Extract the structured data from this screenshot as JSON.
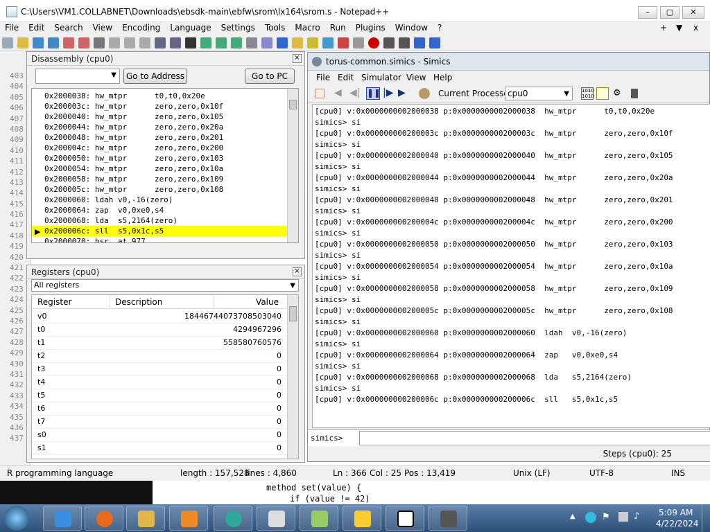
{
  "window": {
    "title": "C:\\Users\\VM1.COLLABNET\\Downloads\\ebsdk-main\\ebfw\\srom\\lx164\\srom.s - Notepad++"
  },
  "menu": [
    "File",
    "Edit",
    "Search",
    "View",
    "Encoding",
    "Language",
    "Settings",
    "Tools",
    "Macro",
    "Run",
    "Plugins",
    "Window",
    "?"
  ],
  "menu_right": {
    "plus": "+",
    "down": "▼",
    "close": "x"
  },
  "line_numbers": [
    "403",
    "404",
    "405",
    "406",
    "407",
    "408",
    "409",
    "410",
    "411",
    "412",
    "413",
    "414",
    "415",
    "416",
    "417",
    "418",
    "419",
    "420",
    "421",
    "422",
    "423",
    "424",
    "425",
    "426",
    "427",
    "428",
    "429",
    "430",
    "431",
    "432",
    "433",
    "434",
    "435",
    "436",
    "437"
  ],
  "disassembly": {
    "title": "Disassembly (cpu0)",
    "go_address": "Go to Address",
    "go_pc": "Go to PC",
    "rows": [
      "0x2000038: hw_mtpr      t0,t0,0x20e",
      "0x200003c: hw_mtpr      zero,zero,0x10f",
      "0x2000040: hw_mtpr      zero,zero,0x105",
      "0x2000044: hw_mtpr      zero,zero,0x20a",
      "0x2000048: hw_mtpr      zero,zero,0x201",
      "0x200004c: hw_mtpr      zero,zero,0x200",
      "0x2000050: hw_mtpr      zero,zero,0x103",
      "0x2000054: hw_mtpr      zero,zero,0x10a",
      "0x2000058: hw_mtpr      zero,zero,0x109",
      "0x200005c: hw_mtpr      zero,zero,0x108",
      "0x2000060: ldah v0,-16(zero)",
      "0x2000064: zap  v0,0xe0,s4",
      "0x2000068: lda  s5,2164(zero)",
      "0x200006c: sll  s5,0x1c,s5",
      "0x2000070: bsr  at,977"
    ],
    "highlight_index": 13
  },
  "registers": {
    "title": "Registers (cpu0)",
    "filter": "All registers",
    "headers": [
      "Register",
      "Description",
      "Value"
    ],
    "rows": [
      [
        "v0",
        "",
        "18446744073708503040"
      ],
      [
        "t0",
        "",
        "4294967296"
      ],
      [
        "t1",
        "",
        "558580760576"
      ],
      [
        "t2",
        "",
        "0"
      ],
      [
        "t3",
        "",
        "0"
      ],
      [
        "t4",
        "",
        "0"
      ],
      [
        "t5",
        "",
        "0"
      ],
      [
        "t6",
        "",
        "0"
      ],
      [
        "t7",
        "",
        "0"
      ],
      [
        "s0",
        "",
        "0"
      ],
      [
        "s1",
        "",
        "0"
      ]
    ]
  },
  "simics": {
    "title": "torus-common.simics - Simics",
    "menu": [
      "File",
      "Edit",
      "Simulator",
      "View",
      "Help"
    ],
    "current_processor_label": "Current Processor:",
    "current_processor": "cpu0",
    "console": [
      "[cpu0] v:0x0000000002000038 p:0x0000000002000038  hw_mtpr      t0,t0,0x20e",
      "simics> si",
      "[cpu0] v:0x000000000200003c p:0x000000000200003c  hw_mtpr      zero,zero,0x10f",
      "simics> si",
      "[cpu0] v:0x0000000002000040 p:0x0000000002000040  hw_mtpr      zero,zero,0x105",
      "simics> si",
      "[cpu0] v:0x0000000002000044 p:0x0000000002000044  hw_mtpr      zero,zero,0x20a",
      "simics> si",
      "[cpu0] v:0x0000000002000048 p:0x0000000002000048  hw_mtpr      zero,zero,0x201",
      "simics> si",
      "[cpu0] v:0x000000000200004c p:0x000000000200004c  hw_mtpr      zero,zero,0x200",
      "simics> si",
      "[cpu0] v:0x0000000002000050 p:0x0000000002000050  hw_mtpr      zero,zero,0x103",
      "simics> si",
      "[cpu0] v:0x0000000002000054 p:0x0000000002000054  hw_mtpr      zero,zero,0x10a",
      "simics> si",
      "[cpu0] v:0x0000000002000058 p:0x0000000002000058  hw_mtpr      zero,zero,0x109",
      "simics> si",
      "[cpu0] v:0x000000000200005c p:0x000000000200005c  hw_mtpr      zero,zero,0x108",
      "simics> si",
      "[cpu0] v:0x0000000002000060 p:0x0000000002000060  ldah  v0,-16(zero)",
      "simics> si",
      "[cpu0] v:0x0000000002000064 p:0x0000000002000064  zap   v0,0xe0,s4",
      "simics> si",
      "[cpu0] v:0x0000000002000068 p:0x0000000002000068  lda   s5,2164(zero)",
      "simics> si",
      "[cpu0] v:0x000000000200006c p:0x000000000200006c  sll   s5,0x1c,s5"
    ],
    "prompt": "simics>",
    "steps": "Steps (cpu0): 25"
  },
  "statusbar": {
    "lang": "R programming language",
    "length": "length : 157,528",
    "lines": "lines : 4,860",
    "ln": "Ln : 366",
    "col": "Col : 25",
    "pos": "Pos : 13,419",
    "eol": "Unix (LF)",
    "enc": "UTF-8",
    "ins": "INS"
  },
  "background_code": [
    "method set(value) {",
    "if (value != 42)"
  ],
  "taskbar": {
    "time": "5:09 AM",
    "date": "4/22/2024"
  }
}
